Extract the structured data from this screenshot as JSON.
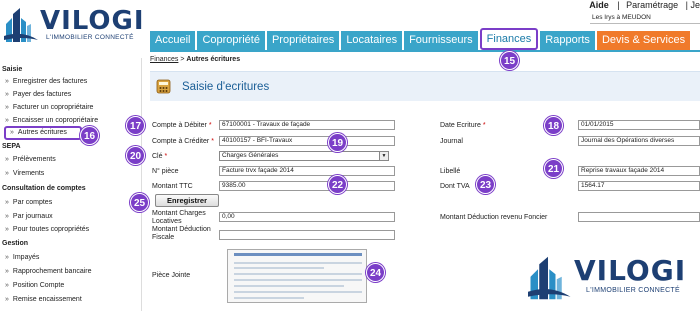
{
  "brand": {
    "name": "VILOGI",
    "tagline": "L'IMMOBILIER CONNECTÉ"
  },
  "toplinks": {
    "aide": "Aide",
    "separator": "|",
    "parametrage": "Paramétrage",
    "more": "|   Je"
  },
  "building": "Les Irys à MEUDON",
  "nav": {
    "tabs": [
      {
        "label": "Accueil"
      },
      {
        "label": "Copropriété"
      },
      {
        "label": "Propriétaires"
      },
      {
        "label": "Locataires"
      },
      {
        "label": "Fournisseurs"
      },
      {
        "label": "Finances",
        "active": true
      },
      {
        "label": "Rapports"
      },
      {
        "label": "Devis & Services",
        "accent": "#f07a2a"
      }
    ]
  },
  "sidebar": {
    "sections": [
      {
        "title": "Saisie",
        "items": [
          "Enregistrer des factures",
          "Payer des factures",
          "Facturer un copropriétaire",
          "Encaisser un copropriétaire",
          "Autres écritures"
        ]
      },
      {
        "title": "SEPA",
        "items": [
          "Prélèvements",
          "Virements"
        ]
      },
      {
        "title": "Consultation de comptes",
        "items": [
          "Par comptes",
          "Par journaux",
          "Pour toutes copropriétés"
        ]
      },
      {
        "title": "Gestion",
        "items": [
          "Impayés",
          "Rapprochement bancaire",
          "Position Compte",
          "Remise encaissement"
        ]
      }
    ],
    "active_item": "Autres écritures"
  },
  "breadcrumb": {
    "parent": "Finances",
    "separator": ">",
    "current": "Autres écritures"
  },
  "panel": {
    "title": "Saisie d'ecritures"
  },
  "form": {
    "compte_debiter": {
      "label": "Compte à Débiter",
      "value": "67100001 - Travaux de façade"
    },
    "compte_crediter": {
      "label": "Compte à Créditer",
      "value": "40100157 - BFI-Travaux"
    },
    "cle": {
      "label": "Clé",
      "value": "Charges Générales"
    },
    "numero_piece": {
      "label": "N° pièce",
      "value": "Facture trvx façade 2014"
    },
    "montant_ttc": {
      "label": "Montant TTC",
      "value": "9385.00"
    },
    "date_ecriture": {
      "label": "Date Ecriture",
      "value": "01/01/2015"
    },
    "journal": {
      "label": "Journal",
      "value": "Journal des Opérations diverses"
    },
    "libelle": {
      "label": "Libellé",
      "value": "Reprise travaux façade 2014"
    },
    "dont_tva": {
      "label": "Dont TVA",
      "value": "1564.17"
    },
    "submit": "Enregistrer",
    "charges_locatives": {
      "label_1": "Montant Charges",
      "label_2": "Locatives",
      "value": "0,00"
    },
    "deduction_revenu": {
      "label": "Montant Déduction revenu Foncier",
      "value": ""
    },
    "deduction_fiscale": {
      "label_1": "Montant Déduction",
      "label_2": "Fiscale",
      "value": ""
    },
    "piece_jointe": {
      "label": "Pièce Jointe"
    }
  },
  "callouts": [
    "15",
    "16",
    "17",
    "18",
    "19",
    "20",
    "21",
    "22",
    "23",
    "24",
    "25"
  ],
  "colors": {
    "tab": "#3aa5c9",
    "tab_accent": "#f07a2a",
    "callout": "#7b3ec8",
    "panel": "#eaf1f9",
    "brand": "#1d3f73"
  }
}
